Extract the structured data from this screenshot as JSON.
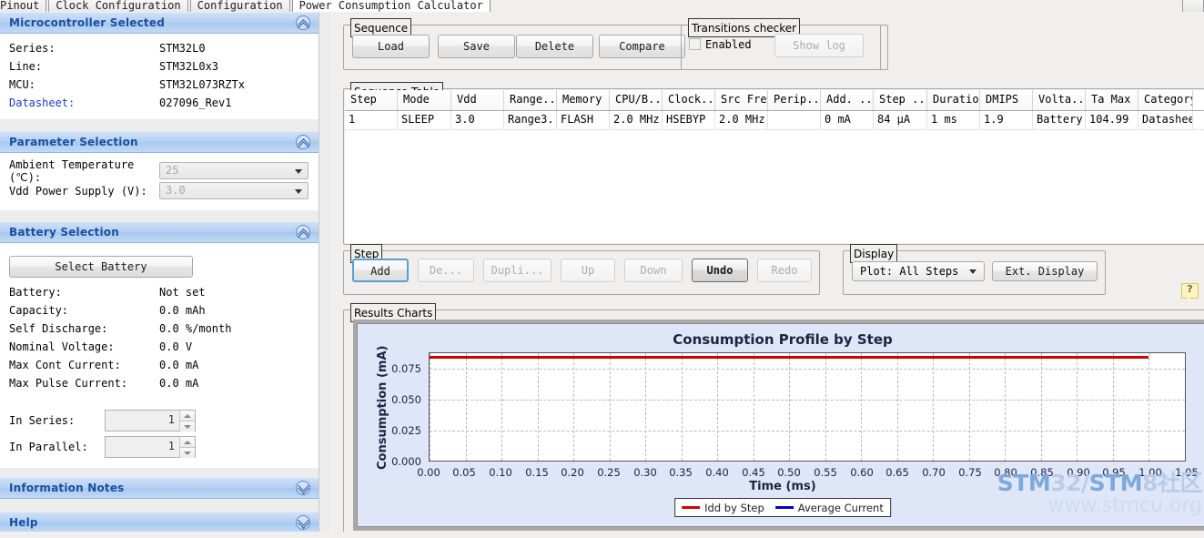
{
  "tabs": [
    {
      "label": "Pinout",
      "active": false
    },
    {
      "label": "Clock Configuration",
      "active": false
    },
    {
      "label": "Configuration",
      "active": false
    },
    {
      "label": "Power Consumption Calculator",
      "active": true
    }
  ],
  "left": {
    "mcu_section": {
      "title": "Microcontroller Selected",
      "rows": [
        {
          "key": "Series:",
          "value": "STM32L0",
          "link": false
        },
        {
          "key": "Line:",
          "value": "STM32L0x3",
          "link": false
        },
        {
          "key": "MCU:",
          "value": "STM32L073RZTx",
          "link": false
        },
        {
          "key": "Datasheet:",
          "value": "027096_Rev1",
          "link": true
        }
      ]
    },
    "parameter_section": {
      "title": "Parameter Selection",
      "fields": [
        {
          "label": "Ambient Temperature (℃):",
          "value": "25"
        },
        {
          "label": "Vdd Power Supply (V):",
          "value": "3.0"
        }
      ]
    },
    "battery_section": {
      "title": "Battery Selection",
      "select_button": "Select Battery",
      "rows": [
        {
          "key": "Battery:",
          "value": "Not set"
        },
        {
          "key": "Capacity:",
          "value": "0.0 mAh"
        },
        {
          "key": "Self Discharge:",
          "value": "0.0 %/month"
        },
        {
          "key": "Nominal Voltage:",
          "value": "0.0 V"
        },
        {
          "key": "Max Cont Current:",
          "value": "0.0 mA"
        },
        {
          "key": "Max Pulse Current:",
          "value": "0.0 mA"
        }
      ],
      "spinners": [
        {
          "label": "In Series:",
          "value": "1"
        },
        {
          "label": "In Parallel:",
          "value": "1"
        }
      ]
    },
    "info_section": {
      "title": "Information Notes"
    },
    "help_section": {
      "title": "Help"
    }
  },
  "right": {
    "sequence_group": {
      "legend": "Sequence",
      "buttons": [
        {
          "label": "Load",
          "disabled": false
        },
        {
          "label": "Save",
          "disabled": false
        },
        {
          "label": "Delete",
          "disabled": false
        },
        {
          "label": "Compare",
          "disabled": false
        }
      ]
    },
    "transitions_group": {
      "legend": "Transitions checker",
      "checkbox_label": "Enabled",
      "checked": false,
      "show_log_label": "Show log",
      "show_log_disabled": true
    },
    "sequence_table": {
      "legend": "Sequence Table",
      "columns": [
        {
          "label": "Step",
          "width": 58
        },
        {
          "label": "Mode",
          "width": 59
        },
        {
          "label": "Vdd",
          "width": 58
        },
        {
          "label": "Range...",
          "width": 58
        },
        {
          "label": "Memory",
          "width": 58
        },
        {
          "label": "CPU/B...",
          "width": 58
        },
        {
          "label": "Clock...",
          "width": 58
        },
        {
          "label": "Src Freq",
          "width": 58
        },
        {
          "label": "Perip...",
          "width": 58
        },
        {
          "label": "Add. ...",
          "width": 58
        },
        {
          "label": "Step ...",
          "width": 59
        },
        {
          "label": "Duration",
          "width": 58
        },
        {
          "label": "DMIPS",
          "width": 58
        },
        {
          "label": "Volta...",
          "width": 58
        },
        {
          "label": "Ta Max",
          "width": 58
        },
        {
          "label": "Category",
          "width": 60
        }
      ],
      "rows": [
        [
          "1",
          "SLEEP",
          "3.0",
          "Range3...",
          "FLASH",
          "2.0 MHz",
          "HSEBYP",
          "2.0 MHz",
          "",
          "0 mA",
          "84 µA",
          "1 ms",
          "1.9",
          "Battery",
          "104.99",
          "Datasheet"
        ]
      ]
    },
    "step_group": {
      "legend": "Step",
      "buttons": [
        {
          "label": "Add",
          "state": "default"
        },
        {
          "label": "De...",
          "state": "disabled"
        },
        {
          "label": "Dupli...",
          "state": "disabled"
        },
        {
          "label": "Up",
          "state": "disabled"
        },
        {
          "label": "Down",
          "state": "disabled"
        },
        {
          "label": "Undo",
          "state": "strong"
        },
        {
          "label": "Redo",
          "state": "disabled"
        }
      ]
    },
    "display_group": {
      "legend": "Display",
      "plot_select": "Plot: All Steps",
      "ext_display_label": "Ext. Display"
    },
    "results_group": {
      "legend": "Results Charts"
    },
    "help_icon": "help-tooltip-icon"
  },
  "chart_data": {
    "type": "line",
    "title": "Consumption Profile by Step",
    "xlabel": "Time (ms)",
    "ylabel": "Consumption (mA)",
    "xlim": [
      0.0,
      1.05
    ],
    "ylim": [
      0.0,
      0.0875
    ],
    "xticks": [
      "0.00",
      "0.05",
      "0.10",
      "0.15",
      "0.20",
      "0.25",
      "0.30",
      "0.35",
      "0.40",
      "0.45",
      "0.50",
      "0.55",
      "0.60",
      "0.65",
      "0.70",
      "0.75",
      "0.80",
      "0.85",
      "0.90",
      "0.95",
      "1.00",
      "1.05"
    ],
    "yticks": [
      "0.000",
      "0.025",
      "0.050",
      "0.075"
    ],
    "grid": true,
    "legend_position": "bottom-center",
    "series": [
      {
        "name": "Idd by Step",
        "color": "#d00000",
        "x": [
          0.0,
          1.0
        ],
        "values": [
          0.084,
          0.084
        ]
      },
      {
        "name": "Average Current",
        "color": "#0000c8",
        "x": [],
        "values": []
      }
    ]
  },
  "watermark": {
    "line1_a": "STM",
    "line1_b": "32/",
    "line1_c": "STM",
    "line1_d": "8社区",
    "line2": "www.stmcu.org"
  }
}
